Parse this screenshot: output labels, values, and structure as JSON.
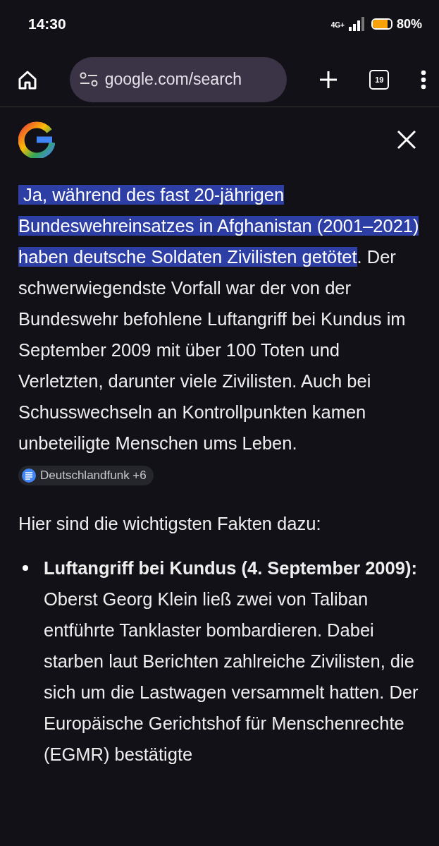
{
  "status_bar": {
    "time": "14:30",
    "network": "4G+",
    "battery": {
      "level": 0.8,
      "reading": "80%"
    }
  },
  "toolbar": {
    "url": "google.com/search",
    "tab_count": "19"
  },
  "answer": {
    "highlighted": "Ja, während des fast 20-jährigen Bundeswehreinsatzes in Afghanistan (2001–2021) haben deutsche Soldaten Zivilisten getötet",
    "rest": ". Der schwerwiegendste Vorfall war der von der Bundeswehr befohlene Luftangriff bei Kundus im September 2009 mit über 100 Toten und Verletzten, darunter viele Zivilisten. Auch bei Schusswechseln an Kontrollpunkten kamen unbeteiligte Menschen ums Leben.",
    "source": "Deutschlandfunk +6"
  },
  "intro": "Hier sind die wichtigsten Fakten dazu:",
  "bullets": [
    {
      "text": "**Luftangriff bei Kundus (4. September 2009):** Oberst Georg Klein ließ zwei von Taliban entführte Tanklaster bombardieren. Dabei starben laut Berichten zahlreiche Zivilisten, die sich um die Lastwagen versammelt hatten. Der Europäische Gerichtshof für Menschenrechte (EGMR) bestätigte"
    }
  ]
}
